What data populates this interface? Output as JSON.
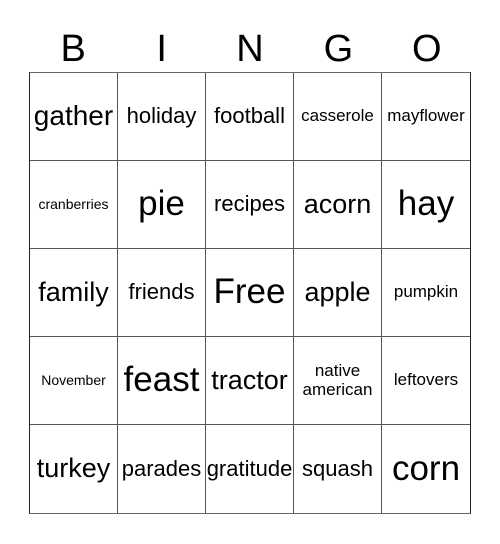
{
  "header": [
    "B",
    "I",
    "N",
    "G",
    "O"
  ],
  "cells": [
    {
      "text": "gather",
      "size": "huge"
    },
    {
      "text": "holiday",
      "size": "mid"
    },
    {
      "text": "football",
      "size": "mid"
    },
    {
      "text": "casserole",
      "size": "small"
    },
    {
      "text": "mayflower",
      "size": "small"
    },
    {
      "text": "cranberries",
      "size": "tiny"
    },
    {
      "text": "pie",
      "size": "xl"
    },
    {
      "text": "recipes",
      "size": "mid"
    },
    {
      "text": "acorn",
      "size": "large"
    },
    {
      "text": "hay",
      "size": "xl"
    },
    {
      "text": "family",
      "size": "large"
    },
    {
      "text": "friends",
      "size": "mid"
    },
    {
      "text": "Free",
      "size": "xl"
    },
    {
      "text": "apple",
      "size": "large"
    },
    {
      "text": "pumpkin",
      "size": "small"
    },
    {
      "text": "November",
      "size": "tiny"
    },
    {
      "text": "feast",
      "size": "xl"
    },
    {
      "text": "tractor",
      "size": "large"
    },
    {
      "text": "native american",
      "size": "small"
    },
    {
      "text": "leftovers",
      "size": "small"
    },
    {
      "text": "turkey",
      "size": "large"
    },
    {
      "text": "parades",
      "size": "mid"
    },
    {
      "text": "gratitude",
      "size": "mid"
    },
    {
      "text": "squash",
      "size": "mid"
    },
    {
      "text": "corn",
      "size": "xl"
    }
  ]
}
